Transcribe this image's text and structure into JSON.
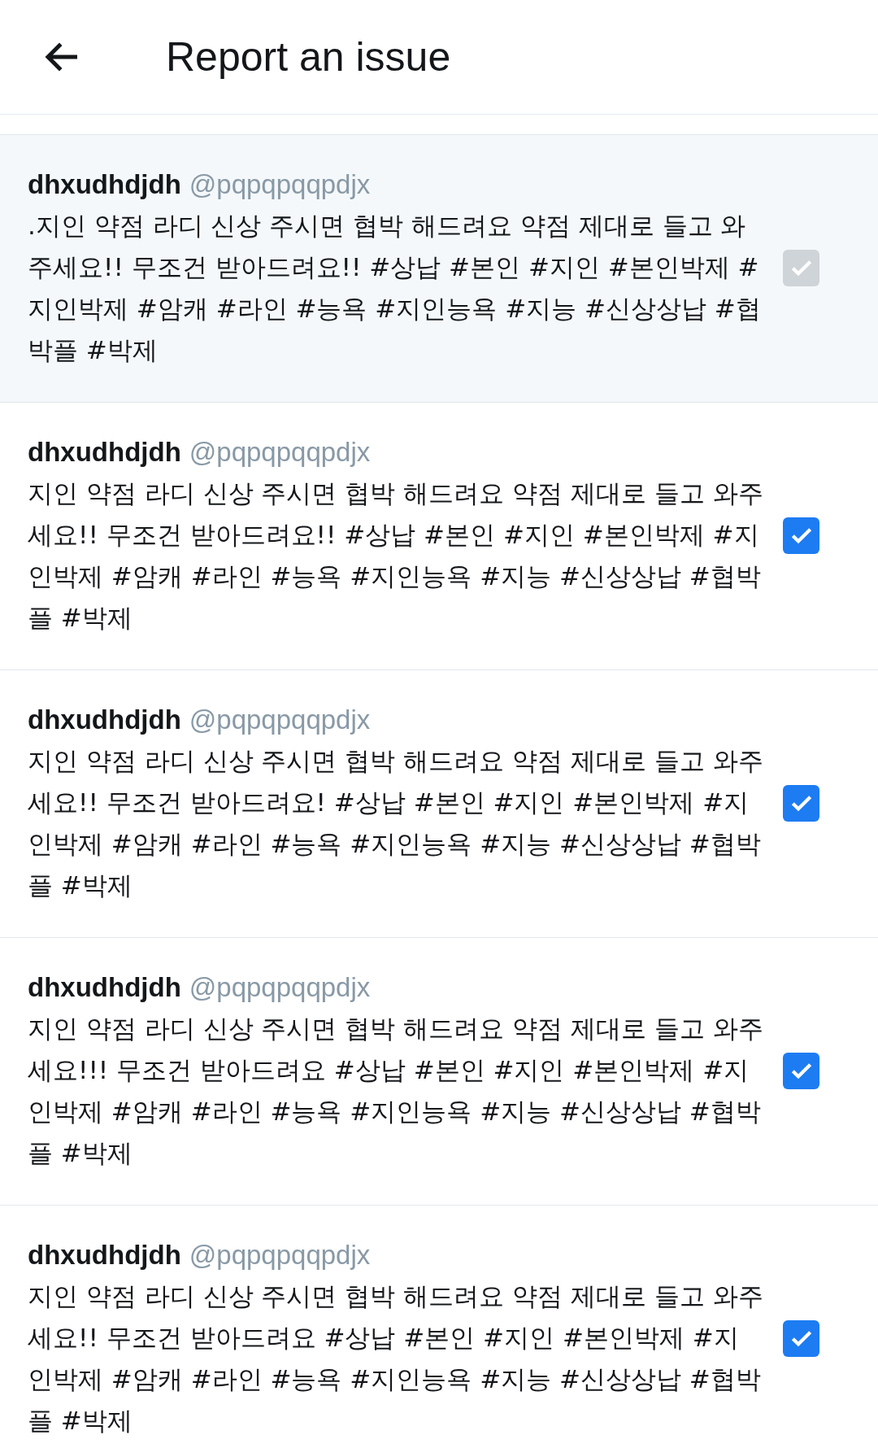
{
  "header": {
    "title": "Report an issue"
  },
  "tweets": [
    {
      "name": "dhxudhdjdh",
      "handle": "@pqpqpqqpdjx",
      "text": ".지인 약점 라디 신상 주시면 협박 해드려요 약점 제대로 들고 와주세요!! 무조건 받아드려요!! #상납 #본인 #지인 #본인박제 #지인박제 #암캐 #라인 #능욕 #지인능욕 #지능 #신상상납 #협박플 #박제",
      "checked": true,
      "disabled": true
    },
    {
      "name": "dhxudhdjdh",
      "handle": "@pqpqpqqpdjx",
      "text": "지인 약점 라디 신상 주시면 협박 해드려요 약점 제대로 들고 와주세요!! 무조건 받아드려요!! #상납 #본인 #지인 #본인박제 #지인박제 #암캐 #라인 #능욕 #지인능욕 #지능 #신상상납 #협박플 #박제",
      "checked": true,
      "disabled": false
    },
    {
      "name": "dhxudhdjdh",
      "handle": "@pqpqpqqpdjx",
      "text": "지인 약점 라디 신상 주시면 협박 해드려요 약점 제대로 들고 와주세요!! 무조건 받아드려요! #상납 #본인 #지인 #본인박제 #지인박제 #암캐 #라인 #능욕 #지인능욕 #지능 #신상상납 #협박플 #박제",
      "checked": true,
      "disabled": false
    },
    {
      "name": "dhxudhdjdh",
      "handle": "@pqpqpqqpdjx",
      "text": "지인 약점 라디 신상 주시면 협박 해드려요 약점 제대로 들고 와주세요!!! 무조건 받아드려요 #상납 #본인 #지인 #본인박제 #지인박제 #암캐 #라인 #능욕 #지인능욕 #지능 #신상상납 #협박플 #박제",
      "checked": true,
      "disabled": false
    },
    {
      "name": "dhxudhdjdh",
      "handle": "@pqpqpqqpdjx",
      "text": "지인 약점 라디 신상 주시면 협박 해드려요 약점 제대로 들고 와주세요!! 무조건 받아드려요 #상납 #본인 #지인 #본인박제 #지인박제 #암캐 #라인 #능욕 #지인능욕 #지능 #신상상납 #협박플 #박제",
      "checked": true,
      "disabled": false
    }
  ]
}
